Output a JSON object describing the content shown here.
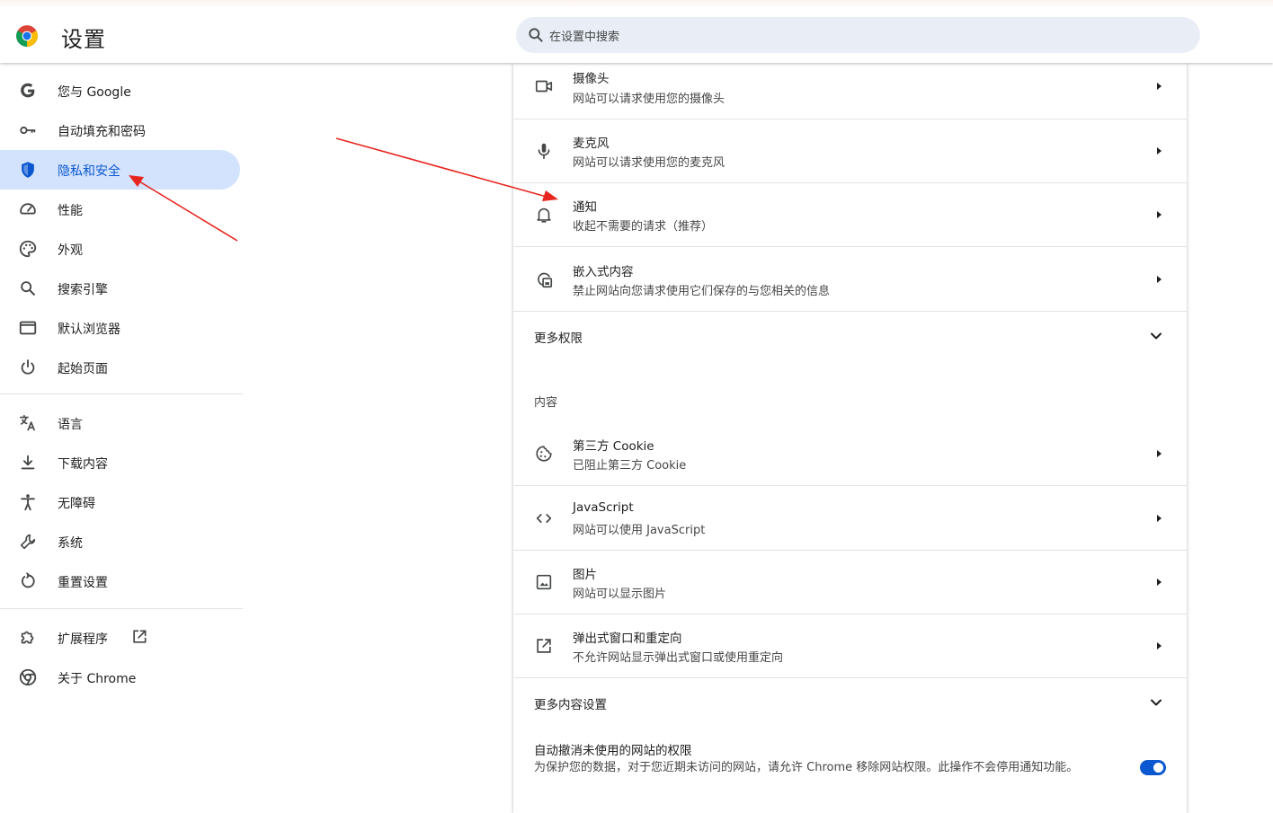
{
  "header": {
    "title": "设置",
    "search_placeholder": "在设置中搜索",
    "logo": "chrome-logo"
  },
  "sidebar": {
    "items": [
      {
        "label": "您与 Google",
        "icon": "google-g-icon"
      },
      {
        "label": "自动填充和密码",
        "icon": "key-icon"
      },
      {
        "label": "隐私和安全",
        "icon": "shield-icon",
        "active": true
      },
      {
        "label": "性能",
        "icon": "speedometer-icon"
      },
      {
        "label": "外观",
        "icon": "palette-icon"
      },
      {
        "label": "搜索引擎",
        "icon": "search-icon"
      },
      {
        "label": "默认浏览器",
        "icon": "browser-window-icon"
      },
      {
        "label": "起始页面",
        "icon": "power-icon"
      },
      {
        "label": "语言",
        "icon": "translate-icon"
      },
      {
        "label": "下载内容",
        "icon": "download-icon"
      },
      {
        "label": "无障碍",
        "icon": "accessibility-icon"
      },
      {
        "label": "系统",
        "icon": "wrench-icon"
      },
      {
        "label": "重置设置",
        "icon": "reset-icon"
      },
      {
        "label": "扩展程序",
        "icon": "puzzle-icon"
      },
      {
        "label": "关于 Chrome",
        "icon": "chrome-icon"
      }
    ]
  },
  "permissions": [
    {
      "title": "摄像头",
      "subtitle": "网站可以请求使用您的摄像头",
      "icon": "camera-icon"
    },
    {
      "title": "麦克风",
      "subtitle": "网站可以请求使用您的麦克风",
      "icon": "microphone-icon"
    },
    {
      "title": "通知",
      "subtitle": "收起不需要的请求（推荐）",
      "icon": "bell-icon"
    },
    {
      "title": "嵌入式内容",
      "subtitle": "禁止网站向您请求使用它们保存的与您相关的信息",
      "icon": "embedded-content-icon"
    }
  ],
  "more_permissions": "更多权限",
  "content_heading": "内容",
  "content_items": [
    {
      "title": "第三方 Cookie",
      "subtitle": "已阻止第三方 Cookie",
      "icon": "cookie-icon"
    },
    {
      "title": "JavaScript",
      "subtitle": "网站可以使用 JavaScript",
      "icon": "code-icon"
    },
    {
      "title": "图片",
      "subtitle": "网站可以显示图片",
      "icon": "image-icon"
    },
    {
      "title": "弹出式窗口和重定向",
      "subtitle": "不允许网站显示弹出式窗口或使用重定向",
      "icon": "open-external-icon"
    }
  ],
  "more_content_settings": "更多内容设置",
  "auto_revoke": {
    "title": "自动撤消未使用的网站的权限",
    "description": "为保护您的数据，对于您近期未访问的网站，请允许 Chrome 移除网站权限。此操作不会停用通知功能。",
    "enabled": true
  },
  "colors": {
    "accent": "#0b57d0",
    "active_nav_bg": "#d3e3fd",
    "search_bg": "#e9eef6",
    "annotation_arrow": "#e8261f"
  }
}
